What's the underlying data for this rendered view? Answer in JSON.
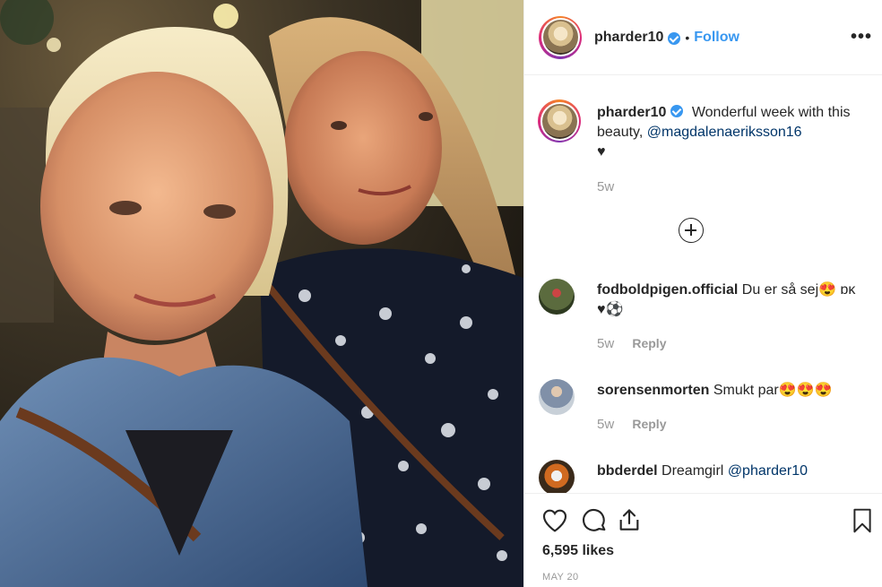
{
  "post": {
    "author": "pharder10",
    "follow_label": "Follow",
    "separator": "•",
    "more_label": "•••",
    "caption": {
      "username": "pharder10",
      "text": "Wonderful week with this beauty,",
      "mention": "@magdalenaeriksson16",
      "emoji": "♥",
      "time": "5w"
    },
    "comments": [
      {
        "username": "fodboldpigen.official",
        "text": "Du er så sej😍 ɒĸ",
        "text2": "♥⚽",
        "time": "5w",
        "reply": "Reply"
      },
      {
        "username": "sorensenmorten",
        "text": "Smukt par😍😍😍",
        "time": "5w",
        "reply": "Reply"
      },
      {
        "username": "bbderdel",
        "text": "Dreamgirl",
        "mention": "@pharder10"
      }
    ],
    "likes": "6,595 likes",
    "date": "MAY 20"
  },
  "icons": {
    "verified": "verified-badge-icon",
    "like": "heart-icon",
    "comment": "comment-bubble-icon",
    "share": "share-icon",
    "save": "bookmark-icon",
    "load_more": "plus-circle-icon"
  },
  "colors": {
    "link_blue": "#3897f0",
    "mention_blue": "#003569",
    "text": "#262626",
    "muted": "#999999"
  }
}
